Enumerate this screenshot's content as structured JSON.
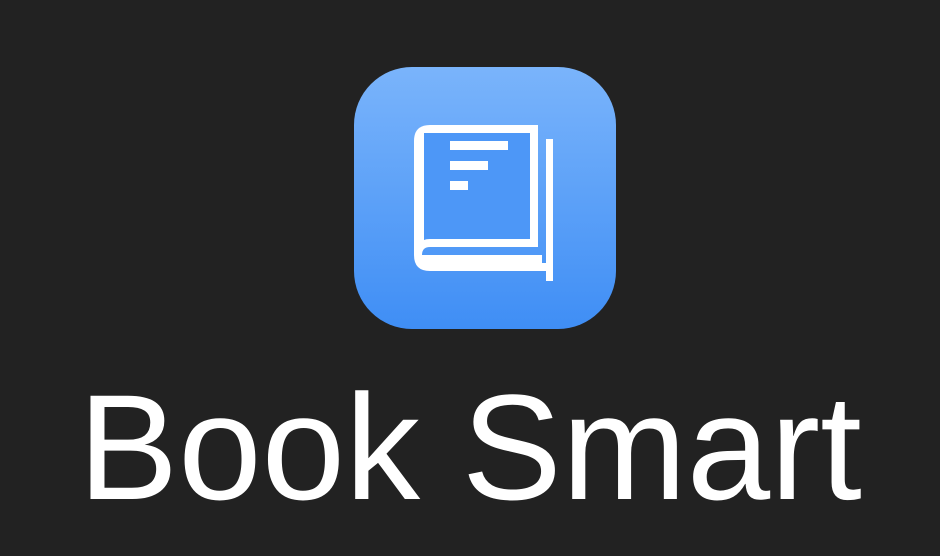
{
  "app": {
    "name": "Book Smart",
    "icon": "book-icon",
    "icon_gradient_top": "#7ab4fb",
    "icon_gradient_bottom": "#3f8ef5",
    "background": "#222222",
    "text_color": "#ffffff"
  }
}
